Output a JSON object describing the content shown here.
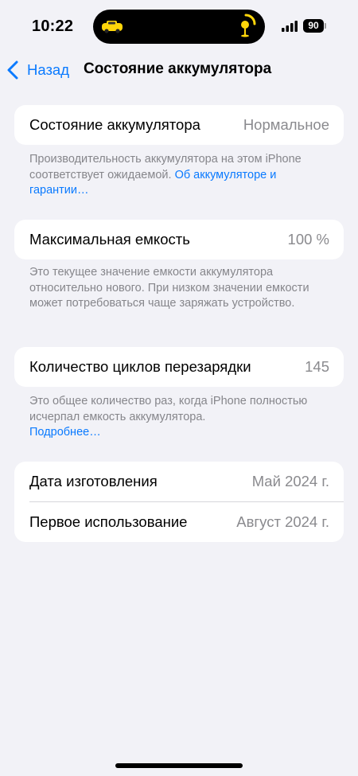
{
  "status_bar": {
    "time": "10:22",
    "battery_level": "90",
    "accent_yellow": "#ffd60a"
  },
  "nav": {
    "back_label": "Назад",
    "title": "Состояние аккумулятора"
  },
  "battery_health": {
    "label": "Состояние аккумулятора",
    "value": "Нормальное",
    "footnote_text": "Производительность аккумулятора на этом iPhone соответствует ожидаемой. ",
    "footnote_link": "Об аккумуляторе и гарантии…"
  },
  "max_capacity": {
    "label": "Максимальная емкость",
    "value": "100 %",
    "footnote_text": "Это текущее значение емкости аккумулятора относительно нового. При низком значении емкости может потребоваться чаще заряжать устройство."
  },
  "cycle_count": {
    "label": "Количество циклов перезарядки",
    "value": "145",
    "footnote_text": "Это общее количество раз, когда iPhone полностью исчерпал емкость аккумулятора.",
    "footnote_link": "Подробнее…"
  },
  "dates": {
    "manufacture_label": "Дата изготовления",
    "manufacture_value": "Май 2024 г.",
    "first_use_label": "Первое использование",
    "first_use_value": "Август 2024 г."
  },
  "colors": {
    "background": "#f2f2f7",
    "link_blue": "#0a7aff",
    "secondary_text": "#8a8a8e"
  }
}
